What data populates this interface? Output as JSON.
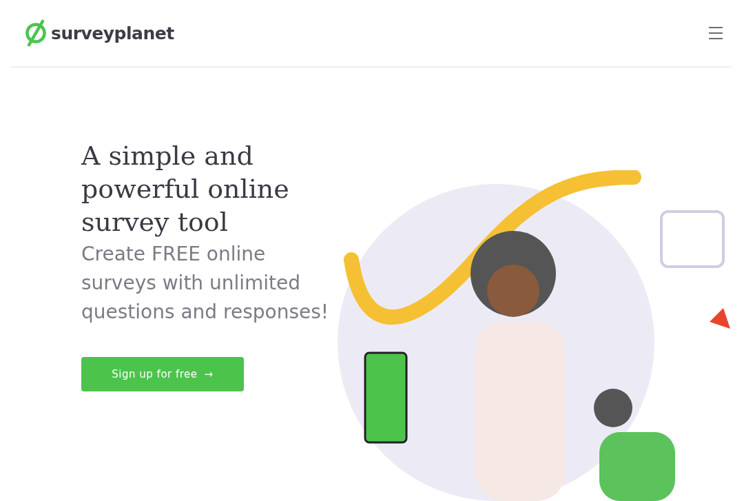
{
  "header": {
    "logo_text": "surveyplanet"
  },
  "hero": {
    "headline": "A simple and powerful online survey tool",
    "subheadline": "Create FREE online surveys with unlimited questions and responses!",
    "cta_button": {
      "label": "Sign up for free",
      "arrow": "→"
    }
  }
}
